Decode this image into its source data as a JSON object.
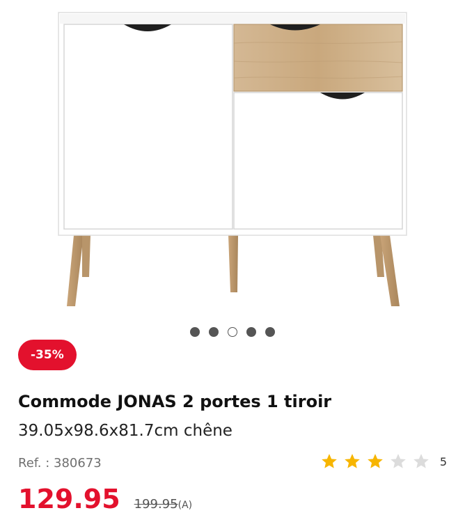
{
  "product": {
    "discount": "-35%",
    "title": "Commode JONAS 2 portes 1 tiroir",
    "subtitle": "39.05x98.6x81.7cm chêne",
    "ref": "Ref. : 380673",
    "rating_value": 3,
    "rating_max": 5,
    "rating_count": "5",
    "price": "129.95",
    "old_price": "199.95",
    "price_note": "(A)"
  },
  "carousel": {
    "total": 5,
    "active_index": 2
  },
  "colors": {
    "accent": "#e3112d",
    "star_filled": "#f7b500",
    "star_empty": "#dcdcdc"
  },
  "icons": {
    "star": "star-icon"
  }
}
